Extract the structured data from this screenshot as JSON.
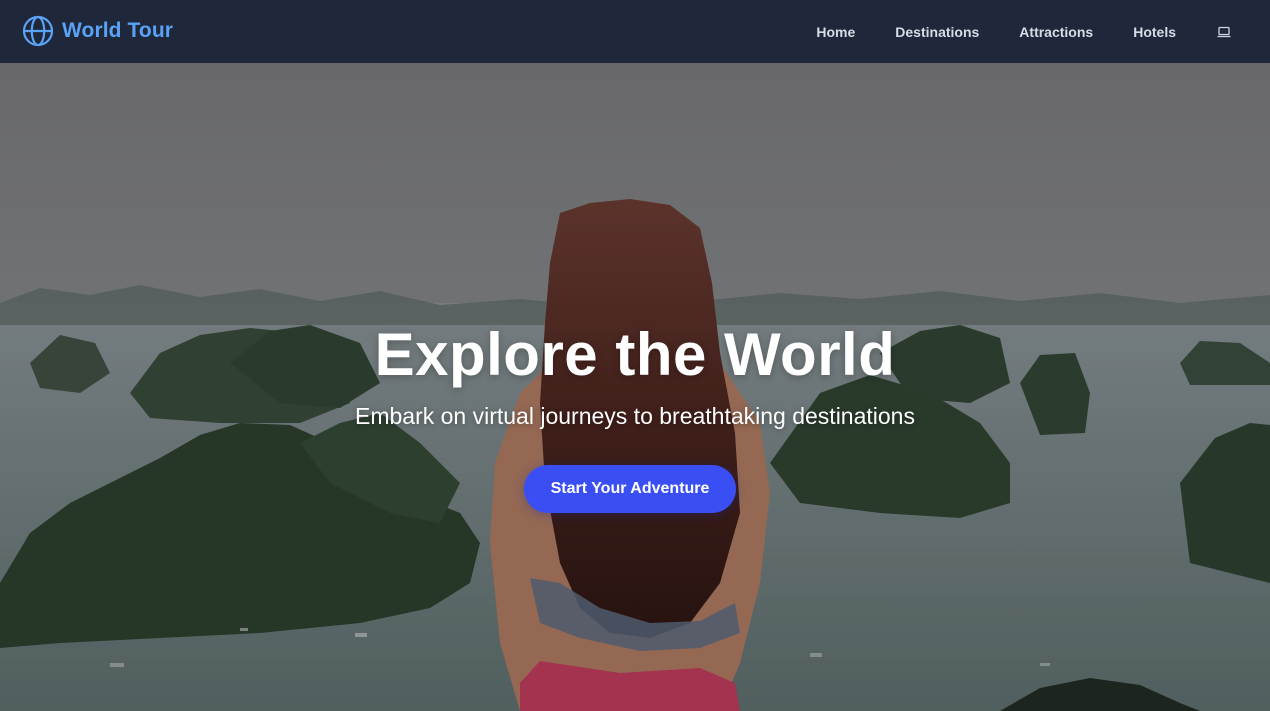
{
  "brand": {
    "name": "World Tour",
    "icon": "globe-icon",
    "color": "#5aa2f5"
  },
  "nav": {
    "links": [
      {
        "label": "Home"
      },
      {
        "label": "Destinations"
      },
      {
        "label": "Attractions"
      },
      {
        "label": "Hotels"
      }
    ],
    "extra_icon": "laptop-icon"
  },
  "hero": {
    "title": "Explore the World",
    "subtitle": "Embark on virtual journeys to breathtaking destinations",
    "cta_label": "Start Your Adventure",
    "cta_color": "#3a4ff3"
  },
  "theme": {
    "navbar_bg": "#1f283b",
    "nav_text": "#d7dce6"
  }
}
